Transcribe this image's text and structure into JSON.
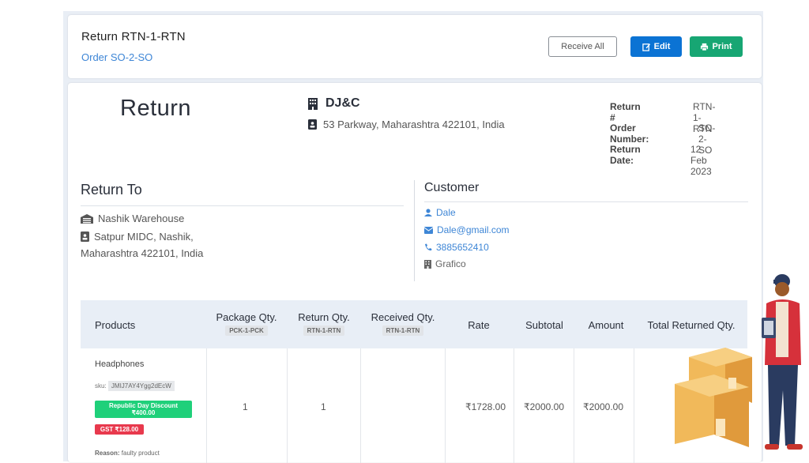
{
  "header": {
    "title": "Return RTN-1-RTN",
    "order_link": "Order SO-2-SO",
    "receive_all": "Receive All",
    "edit": "Edit",
    "print": "Print"
  },
  "doc": {
    "heading": "Return",
    "company": "DJ&C",
    "company_address": "53 Parkway, Maharashtra 422101, India",
    "meta": [
      {
        "label": "Return #",
        "value": "RTN-1-RTN"
      },
      {
        "label": "Order Number:",
        "value": "SO-2-SO"
      },
      {
        "label": "Return Date:",
        "value": "12 Feb 2023"
      }
    ]
  },
  "return_to": {
    "title": "Return To",
    "warehouse": "Nashik Warehouse",
    "address_line1": "Satpur MIDC, Nashik,",
    "address_line2": "Maharashtra 422101, India"
  },
  "customer": {
    "title": "Customer",
    "name": "Dale",
    "email": "Dale@gmail.com",
    "phone": "3885652410",
    "company": "Grafico"
  },
  "table": {
    "headers": {
      "products": "Products",
      "package_qty": "Package Qty.",
      "package_tag": "PCK-1-PCK",
      "return_qty": "Return Qty.",
      "return_tag": "RTN-1-RTN",
      "received_qty": "Received Qty.",
      "received_tag": "RTN-1-RTN",
      "rate": "Rate",
      "subtotal": "Subtotal",
      "amount": "Amount",
      "total_returned": "Total Returned Qty."
    },
    "row": {
      "product": "Headphones",
      "sku_label": "sku:",
      "sku": "JMIJ7AY4Ygg2dEcW",
      "discount_line1": "Republic Day Discount",
      "discount_line2": "₹400.00",
      "gst": "GST ₹128.00",
      "reason_label": "Reason:",
      "reason": "faulty product",
      "package_qty": "1",
      "return_qty": "1",
      "rate": "₹1728.00",
      "subtotal": "₹2000.00",
      "amount": "₹2000.00"
    }
  },
  "colors": {
    "link": "#3e86d6",
    "edit": "#0b73d4",
    "print": "#17a673",
    "discount": "#1fd07a",
    "gst": "#e8394d"
  }
}
